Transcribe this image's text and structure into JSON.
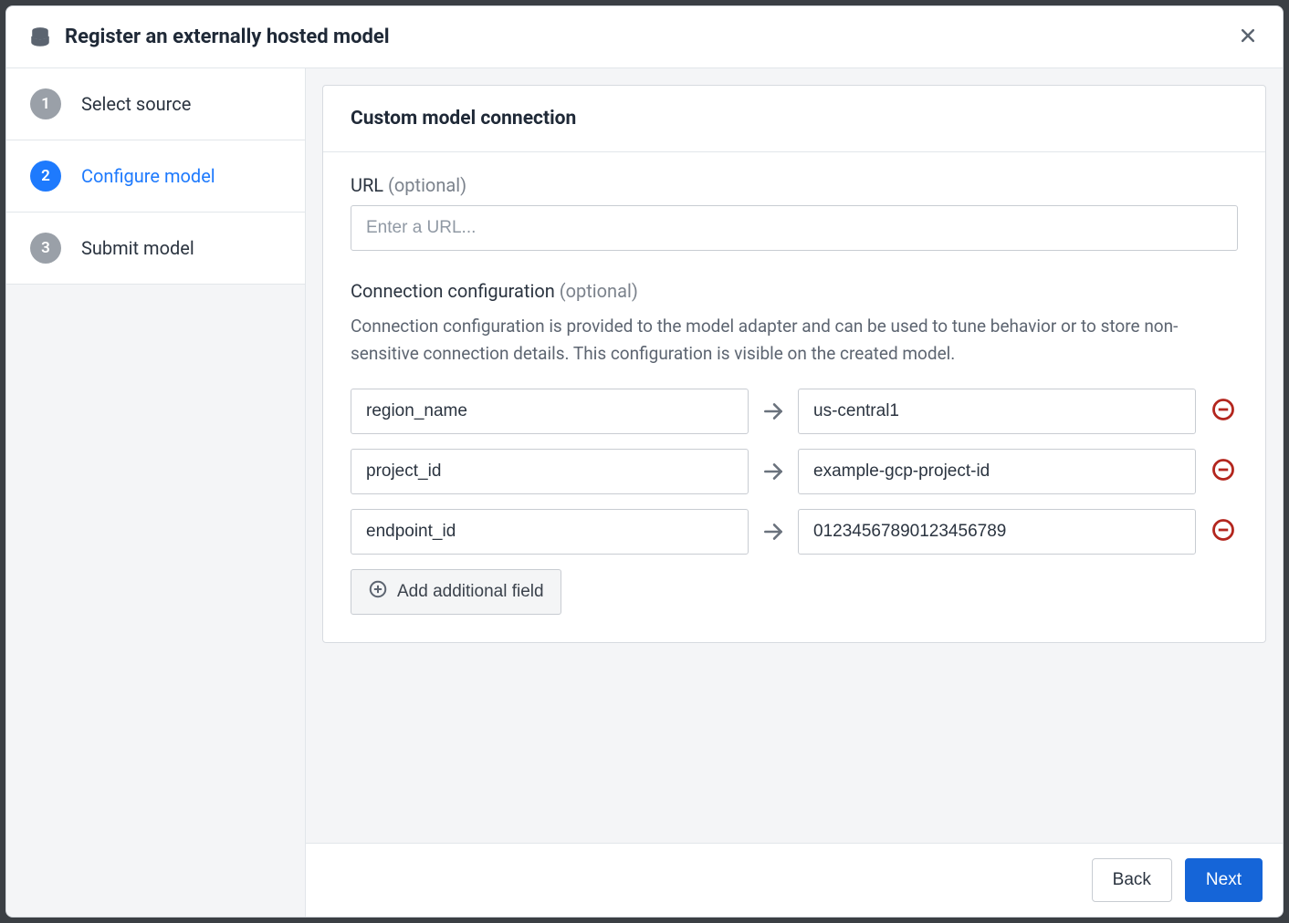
{
  "header": {
    "title": "Register an externally hosted model"
  },
  "sidebar": {
    "steps": [
      {
        "num": "1",
        "label": "Select source",
        "active": false
      },
      {
        "num": "2",
        "label": "Configure model",
        "active": true
      },
      {
        "num": "3",
        "label": "Submit model",
        "active": false
      }
    ]
  },
  "panel": {
    "title": "Custom model connection",
    "url_label": "URL",
    "url_optional": "(optional)",
    "url_placeholder": "Enter a URL...",
    "url_value": "",
    "config_label": "Connection configuration",
    "config_optional": "(optional)",
    "config_help": "Connection configuration is provided to the model adapter and can be used to tune behavior or to store non-sensitive connection details. This configuration is visible on the created model.",
    "rows": [
      {
        "key": "region_name",
        "value": "us-central1"
      },
      {
        "key": "project_id",
        "value": "example-gcp-project-id"
      },
      {
        "key": "endpoint_id",
        "value": "01234567890123456789"
      }
    ],
    "add_field_label": "Add additional field"
  },
  "footer": {
    "back": "Back",
    "next": "Next"
  }
}
